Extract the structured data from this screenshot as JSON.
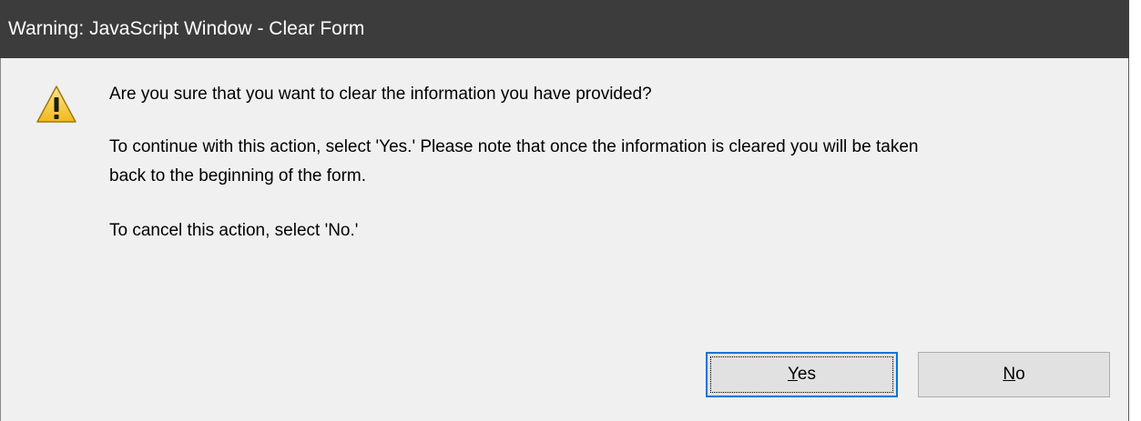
{
  "window": {
    "title": "Warning: JavaScript Window - Clear Form"
  },
  "icon": {
    "name": "warning-icon",
    "fill": "#f7c948",
    "stroke": "#8a6d00"
  },
  "message": {
    "line1": "Are you sure that you want to clear the information you have provided?",
    "line2": "To continue with this action, select 'Yes.' Please note that once the information is cleared you will be taken",
    "line3": "back to the beginning of the form.",
    "line4": "To cancel this action, select 'No.'"
  },
  "buttons": {
    "yes": {
      "mnemonic": "Y",
      "rest": "es",
      "focused": true
    },
    "no": {
      "mnemonic": "N",
      "rest": "o",
      "focused": false
    }
  },
  "colors": {
    "titlebar": "#3c3c3c",
    "background": "#f0f0f0",
    "focus_border": "#0078d7"
  }
}
